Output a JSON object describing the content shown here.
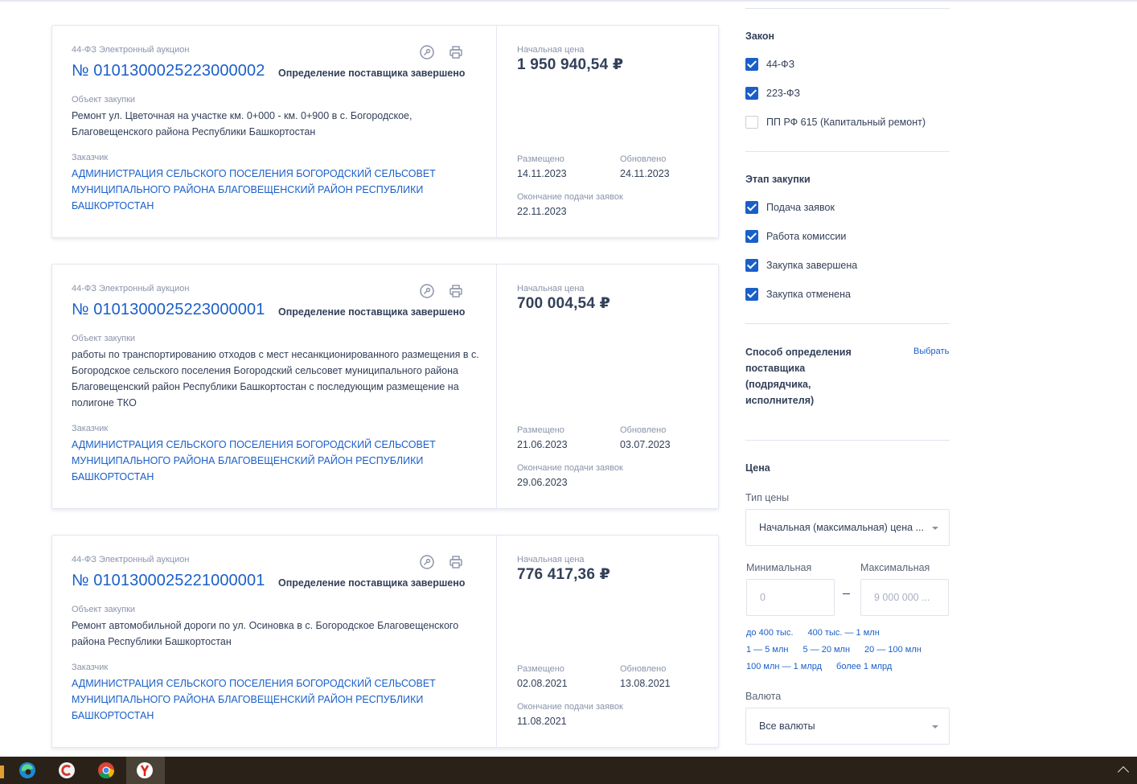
{
  "cards": [
    {
      "law_type": "44-ФЗ Электронный аукцион",
      "reg_number": "№ 0101300025223000002",
      "status": "Определение поставщика завершено",
      "object_label": "Объект закупки",
      "object_text": "Ремонт ул. Цветочная на участке км. 0+000 - км. 0+900 в с. Богородское, Благовещенского района Республики Башкортостан",
      "customer_label": "Заказчик",
      "customer_text": "АДМИНИСТРАЦИЯ СЕЛЬСКОГО ПОСЕЛЕНИЯ БОГОРОДСКИЙ СЕЛЬСОВЕТ МУНИЦИПАЛЬНОГО РАЙОНА БЛАГОВЕЩЕНСКИЙ РАЙОН РЕСПУБЛИКИ БАШКОРТОСТАН",
      "price_label": "Начальная цена",
      "price": "1 950 940,54 ₽",
      "placed_label": "Размещено",
      "placed": "14.11.2023",
      "updated_label": "Обновлено",
      "updated": "24.11.2023",
      "end_label": "Окончание подачи заявок",
      "end": "22.11.2023"
    },
    {
      "law_type": "44-ФЗ Электронный аукцион",
      "reg_number": "№ 0101300025223000001",
      "status": "Определение поставщика завершено",
      "object_label": "Объект закупки",
      "object_text": "работы по транспортированию отходов с мест несанкционированного размещения в с. Богородское сельского поселения Богородский сельсовет муниципального района Благовещенский район Республики Башкортостан с последующим размещение на полигоне ТКО",
      "customer_label": "Заказчик",
      "customer_text": "АДМИНИСТРАЦИЯ СЕЛЬСКОГО ПОСЕЛЕНИЯ БОГОРОДСКИЙ СЕЛЬСОВЕТ МУНИЦИПАЛЬНОГО РАЙОНА БЛАГОВЕЩЕНСКИЙ РАЙОН РЕСПУБЛИКИ БАШКОРТОСТАН",
      "price_label": "Начальная цена",
      "price": "700 004,54 ₽",
      "placed_label": "Размещено",
      "placed": "21.06.2023",
      "updated_label": "Обновлено",
      "updated": "03.07.2023",
      "end_label": "Окончание подачи заявок",
      "end": "29.06.2023"
    },
    {
      "law_type": "44-ФЗ Электронный аукцион",
      "reg_number": "№ 0101300025221000001",
      "status": "Определение поставщика завершено",
      "object_label": "Объект закупки",
      "object_text": "Ремонт автомобильной дороги по ул. Осиновка в с. Богородское Благовещенского района Республики Башкортостан",
      "customer_label": "Заказчик",
      "customer_text": "АДМИНИСТРАЦИЯ СЕЛЬСКОГО ПОСЕЛЕНИЯ БОГОРОДСКИЙ СЕЛЬСОВЕТ МУНИЦИПАЛЬНОГО РАЙОНА БЛАГОВЕЩЕНСКИЙ РАЙОН РЕСПУБЛИКИ БАШКОРТОСТАН",
      "price_label": "Начальная цена",
      "price": "776 417,36 ₽",
      "placed_label": "Размещено",
      "placed": "02.08.2021",
      "updated_label": "Обновлено",
      "updated": "13.08.2021",
      "end_label": "Окончание подачи заявок",
      "end": "11.08.2021"
    }
  ],
  "filters": {
    "law_title": "Закон",
    "law_options": [
      {
        "label": "44-ФЗ",
        "checked": true
      },
      {
        "label": "223-ФЗ",
        "checked": true
      },
      {
        "label": "ПП РФ 615 (Капитальный ремонт)",
        "checked": false
      }
    ],
    "stage_title": "Этап закупки",
    "stage_options": [
      {
        "label": "Подача заявок",
        "checked": true
      },
      {
        "label": "Работа комиссии",
        "checked": true
      },
      {
        "label": "Закупка завершена",
        "checked": true
      },
      {
        "label": "Закупка отменена",
        "checked": true
      }
    ],
    "method_title": "Способ определения поставщика (подрядчика, исполнителя)",
    "method_choose": "Выбрать",
    "price_title": "Цена",
    "price_type_label": "Тип цены",
    "price_type_value": "Начальная (максимальная) цена ...",
    "min_label": "Минимальная",
    "min_placeholder": "0",
    "max_label": "Максимальная",
    "max_placeholder": "9 000 000 ...",
    "chips_row1": [
      "до 400 тыс.",
      "400 тыс. — 1 млн"
    ],
    "chips_row2": [
      "1 — 5 млн",
      "5 — 20 млн",
      "20 — 100 млн"
    ],
    "chips_row3": [
      "100 млн — 1 млрд",
      "более 1 млрд"
    ],
    "currency_label": "Валюта",
    "currency_value": "Все валюты"
  },
  "colors": {
    "link": "#1a5fc8",
    "text": "#334059",
    "muted": "#8a94a9",
    "checkbox": "#1a5fc8",
    "taskbar": "#2a2218"
  },
  "taskbar_icons": [
    "edge-icon",
    "ccleaner-icon",
    "chrome-icon",
    "yandex-browser-icon"
  ]
}
